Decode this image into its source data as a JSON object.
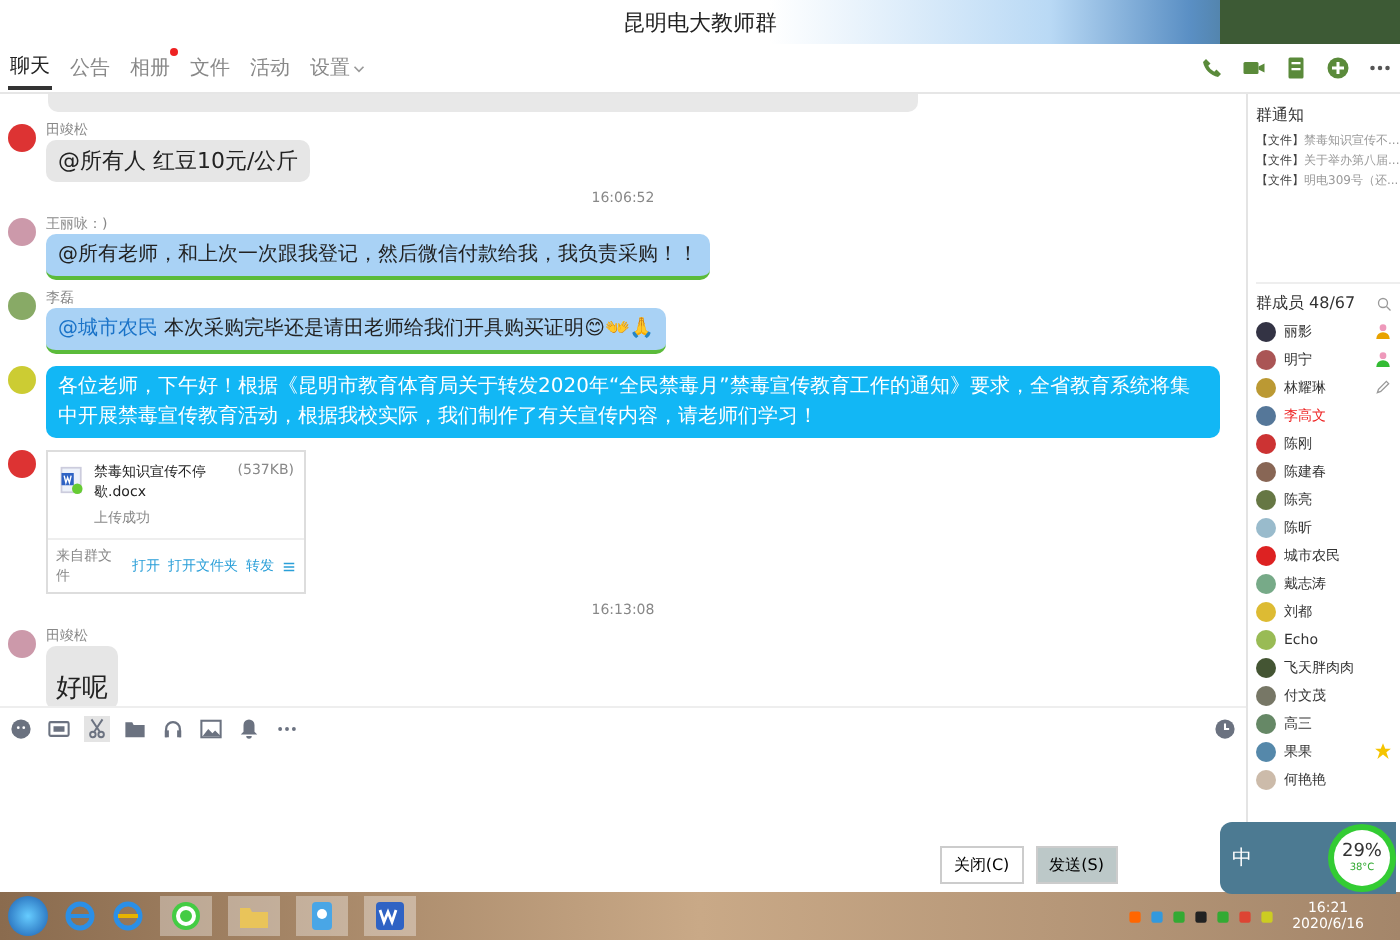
{
  "window": {
    "title": "昆明电大教师群"
  },
  "tabs": [
    {
      "label": "聊天",
      "selected": true,
      "dot": false,
      "caret": false
    },
    {
      "label": "公告",
      "selected": false,
      "dot": false,
      "caret": false
    },
    {
      "label": "相册",
      "selected": false,
      "dot": true,
      "caret": false
    },
    {
      "label": "文件",
      "selected": false,
      "dot": false,
      "caret": false
    },
    {
      "label": "活动",
      "selected": false,
      "dot": false,
      "caret": false
    },
    {
      "label": "设置",
      "selected": false,
      "dot": false,
      "caret": true
    }
  ],
  "messages": [
    {
      "kind": "cut"
    },
    {
      "kind": "gray",
      "sender": "田竣松",
      "text": "@所有人  红豆10元/公斤"
    },
    {
      "kind": "time",
      "text": "16:06:52"
    },
    {
      "kind": "light",
      "sender": "王丽咏：)",
      "text": "@所有老师，和上次一次跟我登记，然后微信付款给我，我负责采购！！"
    },
    {
      "kind": "light",
      "sender": "李磊",
      "mention": "@城市农民",
      "text": " 本次采购完毕还是请田老师给我们开具购买证明😊👐🙏"
    },
    {
      "kind": "blue",
      "text": "各位老师，下午好！根据《昆明市教育体育局关于转发2020年“全民禁毒月”禁毒宣传教育工作的通知》要求，全省教育系统将集中开展禁毒宣传教育活动，根据我校实际，我们制作了有关宣传内容，请老师们学习！"
    },
    {
      "kind": "file",
      "name": "禁毒知识宣传不停歇.docx",
      "size": "(537KB)",
      "status": "上传成功",
      "source": "来自群文件",
      "actions": [
        "打开",
        "打开文件夹",
        "转发"
      ]
    },
    {
      "kind": "time",
      "text": "16:13:08"
    },
    {
      "kind": "gray",
      "sender": "田竣松",
      "big": true,
      "text": "好呢"
    }
  ],
  "buttons": [
    "关闭(C)",
    "发送(S)"
  ],
  "notice": {
    "title": "群通知",
    "items": [
      {
        "tag": "【文件】",
        "text": "禁毒知识宣传不..."
      },
      {
        "tag": "【文件】",
        "text": "关于举办第八届..."
      },
      {
        "tag": "【文件】",
        "text": "明电309号（还..."
      }
    ]
  },
  "members": {
    "title": "群成员 48/67",
    "items": [
      {
        "name": "丽影",
        "kind": "owner",
        "highlight": false
      },
      {
        "name": "明宁",
        "kind": "admin",
        "highlight": false
      },
      {
        "name": "林耀琳",
        "kind": "editor",
        "highlight": false
      },
      {
        "name": "李高文",
        "kind": "member",
        "highlight": true
      },
      {
        "name": "陈刚",
        "kind": "member",
        "highlight": false
      },
      {
        "name": "陈建春",
        "kind": "member",
        "highlight": false
      },
      {
        "name": "陈亮",
        "kind": "member",
        "highlight": false
      },
      {
        "name": "陈昕",
        "kind": "member",
        "highlight": false
      },
      {
        "name": "城市农民",
        "kind": "member",
        "highlight": false
      },
      {
        "name": "戴志涛",
        "kind": "member",
        "highlight": false
      },
      {
        "name": "刘都",
        "kind": "member",
        "highlight": false
      },
      {
        "name": "Echo",
        "kind": "member",
        "highlight": false
      },
      {
        "name": "飞天胖肉肉",
        "kind": "member",
        "highlight": false
      },
      {
        "name": "付文茂",
        "kind": "member",
        "highlight": false
      },
      {
        "name": "高三",
        "kind": "member",
        "highlight": false
      },
      {
        "name": "果果",
        "kind": "starred",
        "highlight": false
      },
      {
        "name": "何艳艳",
        "kind": "member",
        "highlight": false
      }
    ]
  },
  "widget": {
    "ime": "中",
    "percent": "29%",
    "temp": "38°C"
  },
  "taskbar": {
    "time": "16:21",
    "date": "2020/6/16"
  }
}
